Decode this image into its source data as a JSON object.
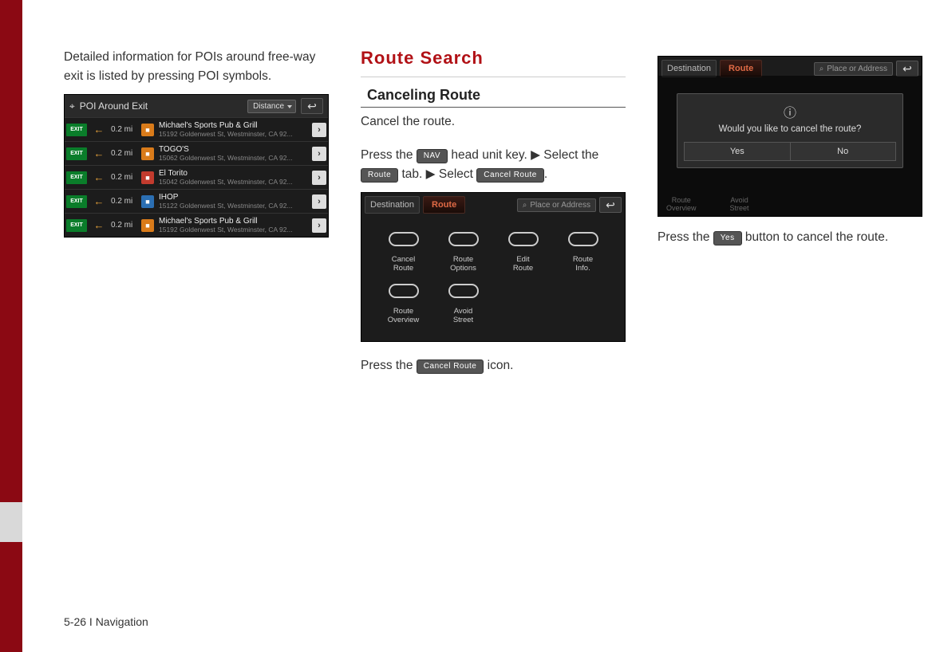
{
  "col1": {
    "intro": "Detailed information for POIs around free-way exit is listed by pressing POI symbols."
  },
  "poi_screen": {
    "title": "POI Around Exit",
    "dropdown": "Distance",
    "rows": [
      {
        "dist": "0.2 mi",
        "cat": "orange",
        "name": "Michael's Sports Pub & Grill",
        "addr": "15192 Goldenwest St, Westminster, CA 92..."
      },
      {
        "dist": "0.2 mi",
        "cat": "orange",
        "name": "TOGO'S",
        "addr": "15062 Goldenwest St, Westminster, CA 92..."
      },
      {
        "dist": "0.2 mi",
        "cat": "red",
        "name": "El Torito",
        "addr": "15042 Goldenwest St, Westminster, CA 92..."
      },
      {
        "dist": "0.2 mi",
        "cat": "blue",
        "name": "IHOP",
        "addr": "15122 Goldenwest St, Westminster, CA 92..."
      },
      {
        "dist": "0.2 mi",
        "cat": "orange",
        "name": "Michael's Sports Pub & Grill",
        "addr": "15192 Goldenwest St, Westminster, CA 92..."
      }
    ]
  },
  "col2": {
    "section": "Route Search",
    "subsection": "Canceling Route",
    "line1": "Cancel the route.",
    "step_a1": "Press the ",
    "key_nav": "NAV",
    "step_a2": " head unit key. ▶ Select the ",
    "key_route": "Route",
    "step_a3": " tab. ▶ Select ",
    "key_cancel": "Cancel Route",
    "step_a4": ".",
    "press_line_a": "Press the ",
    "press_line_b": " icon."
  },
  "route_screen": {
    "tab_dest": "Destination",
    "tab_route": "Route",
    "search_ph": "Place or Address",
    "items": [
      "Cancel\nRoute",
      "Route\nOptions",
      "Edit\nRoute",
      "Route\nInfo.",
      "Route\nOverview",
      "Avoid\nStreet"
    ]
  },
  "dialog_screen": {
    "tab_dest": "Destination",
    "tab_route": "Route",
    "search_ph": "Place or Address",
    "msg": "Would you like to cancel the route?",
    "yes": "Yes",
    "no": "No",
    "ghost_a": "Route\nOverview",
    "ghost_b": "Avoid\nStreet"
  },
  "col3": {
    "line_a": "Press the ",
    "key_yes": "Yes",
    "line_b": " button to cancel the route."
  },
  "footer": "5-26 I Navigation"
}
